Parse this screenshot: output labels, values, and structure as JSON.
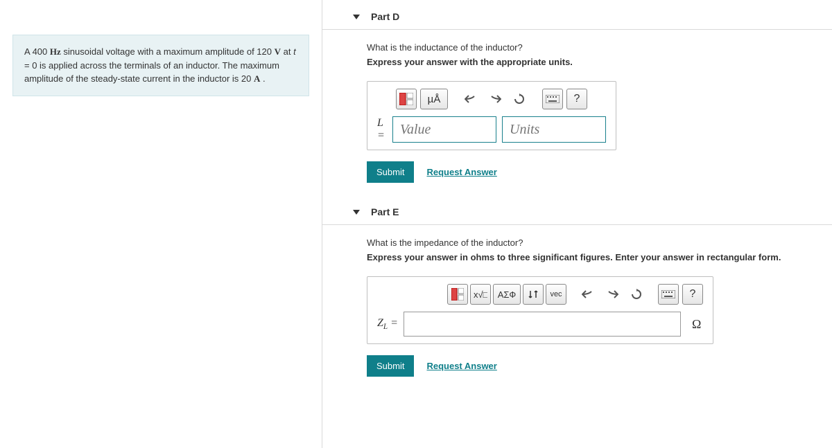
{
  "problem": {
    "text_html": "A 400 <b>Hz</b> sinusoidal voltage with a maximum amplitude of 120 <b>V</b> at <i>t</i> = 0 is applied across the terminals of an inductor. The maximum amplitude of the steady-state current in the inductor is 20 <b>A</b> ."
  },
  "parts": {
    "d": {
      "title": "Part D",
      "question": "What is the inductance of the inductor?",
      "instruction": "Express your answer with the appropriate units.",
      "var_label": "L =",
      "value_placeholder": "Value",
      "units_placeholder": "Units",
      "toolbar": {
        "units_btn": "µÅ",
        "help": "?"
      },
      "submit": "Submit",
      "request": "Request Answer"
    },
    "e": {
      "title": "Part E",
      "question": "What is the impedance of the inductor?",
      "instruction": "Express your answer in ohms to three significant figures. Enter your answer in rectangular form.",
      "var_label_html": "Z<span class=\"sub\">L</span> =",
      "unit_suffix": "Ω",
      "toolbar": {
        "greek": "ΑΣФ",
        "vec": "vec",
        "help": "?"
      },
      "submit": "Submit",
      "request": "Request Answer"
    }
  }
}
